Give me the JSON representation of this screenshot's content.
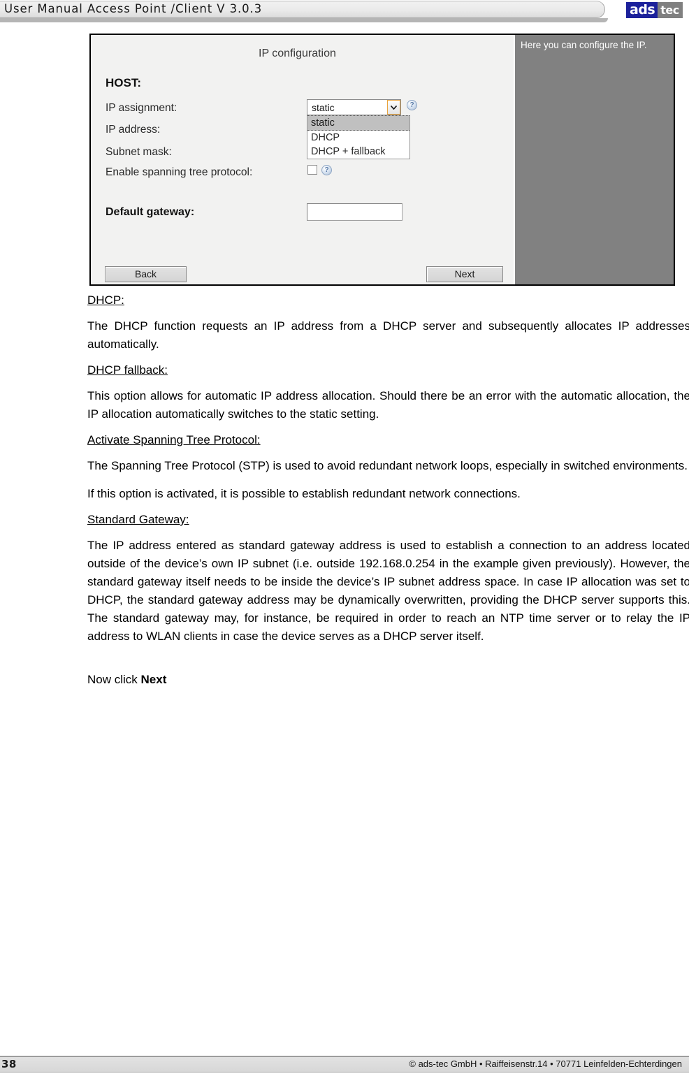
{
  "header": {
    "title": "User Manual Access Point /Client V 3.0.3",
    "logo": {
      "part1": "ads",
      "part2": "tec"
    }
  },
  "screenshot": {
    "heading": "IP configuration",
    "host_label": "HOST:",
    "help_panel_text": "Here you can configure the IP.",
    "fields": {
      "ip_assignment_label": "IP assignment:",
      "ip_address_label": "IP address:",
      "subnet_mask_label": "Subnet mask:",
      "stp_label": "Enable spanning tree protocol:",
      "default_gateway_label": "Default gateway:"
    },
    "values": {
      "ip_assignment_selected": "static",
      "ip_address_value": "",
      "subnet_mask_value": "",
      "default_gateway_value": ""
    },
    "ip_assignment_options": [
      "static",
      "DHCP",
      "DHCP + fallback"
    ],
    "help_icon_glyph": "?",
    "buttons": {
      "back": "Back",
      "next": "Next"
    }
  },
  "document": {
    "sections": [
      {
        "heading": "DHCP:",
        "paragraphs": [
          "The DHCP function requests an IP address from a DHCP server and subsequently allocates IP addresses automatically."
        ]
      },
      {
        "heading": "DHCP fallback:",
        "paragraphs": [
          "This option allows for automatic IP address allocation. Should there be an error with the automatic allocation, the IP allocation automatically switches to the static setting."
        ]
      },
      {
        "heading": "Activate Spanning Tree Protocol:",
        "paragraphs": [
          "The Spanning Tree Protocol (STP) is used to avoid redundant network loops, especially in switched environments.",
          "If this option is activated, it is possible to establish redundant network connections."
        ]
      },
      {
        "heading": "Standard Gateway:",
        "paragraphs": [
          "The IP address entered as standard gateway address is used to establish a connection to an address located outside of the device’s own IP subnet (i.e. outside 192.168.0.254 in the example given previously). However, the standard gateway itself needs to be inside the device’s IP subnet address space. In case IP allocation was set to DHCP, the standard gateway address may be dynamically overwritten, providing the DHCP server supports this. The standard gateway may, for instance, be required in order to reach an NTP time server or to relay the IP address to WLAN clients in case the device serves as a DHCP server itself."
        ]
      }
    ],
    "closing_prefix": "Now click ",
    "closing_bold": "Next"
  },
  "footer": {
    "page_number": "38",
    "copyright": "© ads-tec GmbH • Raiffeisenstr.14 • 70771 Leinfelden-Echterdingen"
  }
}
